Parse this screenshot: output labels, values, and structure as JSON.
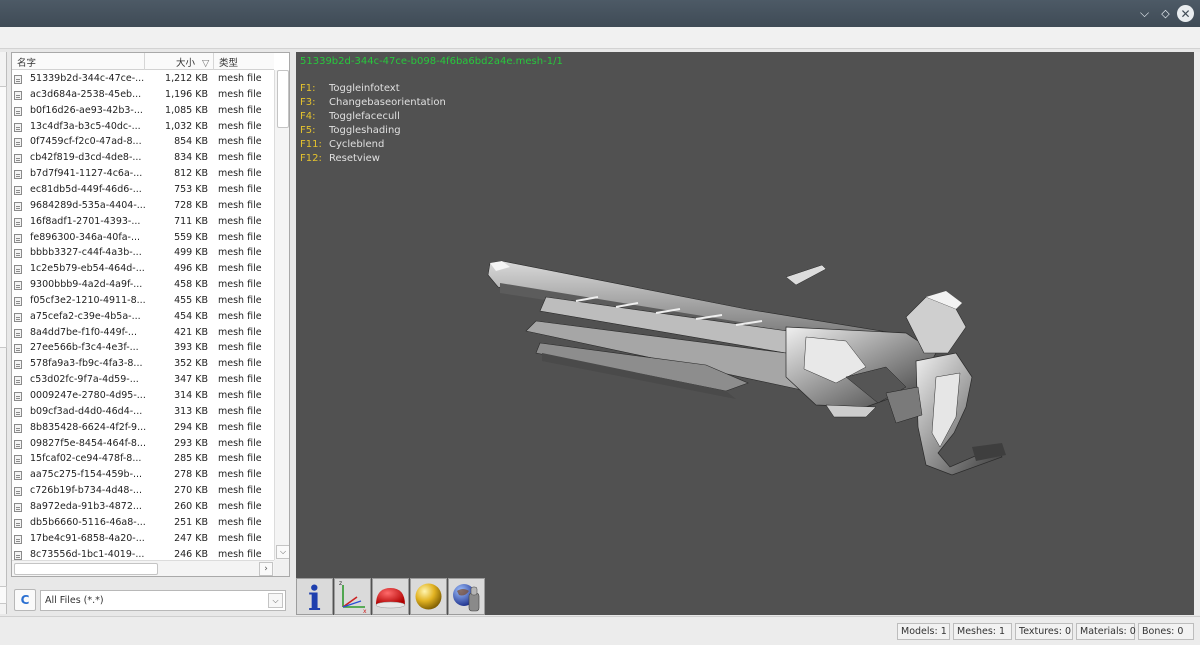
{
  "window": {
    "minimize": "⌵",
    "restore": "◇",
    "close": "✕"
  },
  "file_list": {
    "headers": {
      "name": "名字",
      "size": "大小",
      "sort_indicator": "▽",
      "type": "类型"
    },
    "rows": [
      {
        "name": "51339b2d-344c-47ce-...",
        "size": "1,212 KB",
        "type": "mesh file"
      },
      {
        "name": "ac3d684a-2538-45eb...",
        "size": "1,196 KB",
        "type": "mesh file"
      },
      {
        "name": "b0f16d26-ae93-42b3-...",
        "size": "1,085 KB",
        "type": "mesh file"
      },
      {
        "name": "13c4df3a-b3c5-40dc-...",
        "size": "1,032 KB",
        "type": "mesh file"
      },
      {
        "name": "0f7459cf-f2c0-47ad-8...",
        "size": "854 KB",
        "type": "mesh file"
      },
      {
        "name": "cb42f819-d3cd-4de8-...",
        "size": "834 KB",
        "type": "mesh file"
      },
      {
        "name": "b7d7f941-1127-4c6a-...",
        "size": "812 KB",
        "type": "mesh file"
      },
      {
        "name": "ec81db5d-449f-46d6-...",
        "size": "753 KB",
        "type": "mesh file"
      },
      {
        "name": "9684289d-535a-4404-...",
        "size": "728 KB",
        "type": "mesh file"
      },
      {
        "name": "16f8adf1-2701-4393-...",
        "size": "711 KB",
        "type": "mesh file"
      },
      {
        "name": "fe896300-346a-40fa-...",
        "size": "559 KB",
        "type": "mesh file"
      },
      {
        "name": "bbbb3327-c44f-4a3b-...",
        "size": "499 KB",
        "type": "mesh file"
      },
      {
        "name": "1c2e5b79-eb54-464d-...",
        "size": "496 KB",
        "type": "mesh file"
      },
      {
        "name": "9300bbb9-4a2d-4a9f-...",
        "size": "458 KB",
        "type": "mesh file"
      },
      {
        "name": "f05cf3e2-1210-4911-8...",
        "size": "455 KB",
        "type": "mesh file"
      },
      {
        "name": "a75cefa2-c39e-4b5a-...",
        "size": "454 KB",
        "type": "mesh file"
      },
      {
        "name": "8a4dd7be-f1f0-449f-...",
        "size": "421 KB",
        "type": "mesh file"
      },
      {
        "name": "27ee566b-f3c4-4e3f-...",
        "size": "393 KB",
        "type": "mesh file"
      },
      {
        "name": "578fa9a3-fb9c-4fa3-8...",
        "size": "352 KB",
        "type": "mesh file"
      },
      {
        "name": "c53d02fc-9f7a-4d59-...",
        "size": "347 KB",
        "type": "mesh file"
      },
      {
        "name": "0009247e-2780-4d95-...",
        "size": "314 KB",
        "type": "mesh file"
      },
      {
        "name": "b09cf3ad-d4d0-46d4-...",
        "size": "313 KB",
        "type": "mesh file"
      },
      {
        "name": "8b835428-6624-4f2f-9...",
        "size": "294 KB",
        "type": "mesh file"
      },
      {
        "name": "09827f5e-8454-464f-8...",
        "size": "293 KB",
        "type": "mesh file"
      },
      {
        "name": "15fcaf02-ce94-478f-8...",
        "size": "285 KB",
        "type": "mesh file"
      },
      {
        "name": "aa75c275-f154-459b-...",
        "size": "278 KB",
        "type": "mesh file"
      },
      {
        "name": "c726b19f-b734-4d48-...",
        "size": "270 KB",
        "type": "mesh file"
      },
      {
        "name": "8a972eda-91b3-4872...",
        "size": "260 KB",
        "type": "mesh file"
      },
      {
        "name": "db5b6660-5116-46a8-...",
        "size": "251 KB",
        "type": "mesh file"
      },
      {
        "name": "17be4c91-6858-4a20-...",
        "size": "247 KB",
        "type": "mesh file"
      },
      {
        "name": "8c73556d-1bc1-4019-...",
        "size": "246 KB",
        "type": "mesh file"
      }
    ],
    "scroll_down": "⌵",
    "scroll_right": "›"
  },
  "filter": {
    "refresh_label": "C",
    "value": "All Files (*.*)",
    "arrow": "⌵"
  },
  "viewport": {
    "title": "51339b2d-344c-47ce-b098-4f6ba6bd2a4e.mesh-1/1",
    "title_color": "#27c83c",
    "key_color": "#e4c22e",
    "shortcuts": [
      {
        "key": "F1:",
        "label": "Toggleinfotext"
      },
      {
        "key": "F3:",
        "label": "Changebaseorientation"
      },
      {
        "key": "F4:",
        "label": "Togglefacecull"
      },
      {
        "key": "F5:",
        "label": "Toggleshading"
      },
      {
        "key": "F11:",
        "label": "Cycleblend"
      },
      {
        "key": "F12:",
        "label": "Resetview"
      }
    ],
    "toolbar": {
      "info_glyph": "i",
      "axes_x": "x",
      "axes_z": "z"
    }
  },
  "status": {
    "models": "Models: 1",
    "meshes": "Meshes: 1",
    "textures": "Textures: 0",
    "materials": "Materials: 0",
    "bones": "Bones: 0"
  }
}
